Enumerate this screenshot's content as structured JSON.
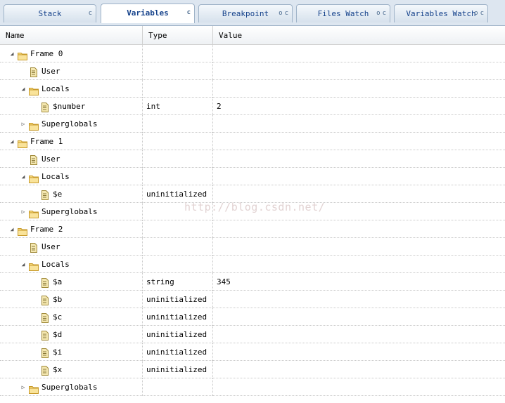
{
  "tabs": [
    {
      "label": "Stack",
      "active": false,
      "ctrls": [
        "c"
      ]
    },
    {
      "label": "Variables",
      "active": true,
      "ctrls": [
        "c"
      ]
    },
    {
      "label": "Breakpoint",
      "active": false,
      "ctrls": [
        "o",
        "c"
      ]
    },
    {
      "label": "Files Watch",
      "active": false,
      "ctrls": [
        "o",
        "c"
      ]
    },
    {
      "label": "Variables Watch",
      "active": false,
      "ctrls": [
        "o",
        "c"
      ]
    }
  ],
  "columns": {
    "name": "Name",
    "type": "Type",
    "value": "Value"
  },
  "rows": [
    {
      "level": 0,
      "kind": "folder",
      "twisty": "open",
      "name": "Frame 0",
      "type": "",
      "value": ""
    },
    {
      "level": 1,
      "kind": "file",
      "twisty": "none",
      "name": "User",
      "type": "",
      "value": ""
    },
    {
      "level": 1,
      "kind": "folder",
      "twisty": "open",
      "name": "Locals",
      "type": "",
      "value": ""
    },
    {
      "level": 2,
      "kind": "file",
      "twisty": "none",
      "name": "$number",
      "type": "int",
      "value": "2"
    },
    {
      "level": 1,
      "kind": "folder",
      "twisty": "closed",
      "name": "Superglobals",
      "type": "",
      "value": ""
    },
    {
      "level": 0,
      "kind": "folder",
      "twisty": "open",
      "name": "Frame 1",
      "type": "",
      "value": ""
    },
    {
      "level": 1,
      "kind": "file",
      "twisty": "none",
      "name": "User",
      "type": "",
      "value": ""
    },
    {
      "level": 1,
      "kind": "folder",
      "twisty": "open",
      "name": "Locals",
      "type": "",
      "value": ""
    },
    {
      "level": 2,
      "kind": "file",
      "twisty": "none",
      "name": "$e",
      "type": "uninitialized",
      "value": ""
    },
    {
      "level": 1,
      "kind": "folder",
      "twisty": "closed",
      "name": "Superglobals",
      "type": "",
      "value": ""
    },
    {
      "level": 0,
      "kind": "folder",
      "twisty": "open",
      "name": "Frame 2",
      "type": "",
      "value": ""
    },
    {
      "level": 1,
      "kind": "file",
      "twisty": "none",
      "name": "User",
      "type": "",
      "value": ""
    },
    {
      "level": 1,
      "kind": "folder",
      "twisty": "open",
      "name": "Locals",
      "type": "",
      "value": ""
    },
    {
      "level": 2,
      "kind": "file",
      "twisty": "none",
      "name": "$a",
      "type": "string",
      "value": "345"
    },
    {
      "level": 2,
      "kind": "file",
      "twisty": "none",
      "name": "$b",
      "type": "uninitialized",
      "value": ""
    },
    {
      "level": 2,
      "kind": "file",
      "twisty": "none",
      "name": "$c",
      "type": "uninitialized",
      "value": ""
    },
    {
      "level": 2,
      "kind": "file",
      "twisty": "none",
      "name": "$d",
      "type": "uninitialized",
      "value": ""
    },
    {
      "level": 2,
      "kind": "file",
      "twisty": "none",
      "name": "$i",
      "type": "uninitialized",
      "value": ""
    },
    {
      "level": 2,
      "kind": "file",
      "twisty": "none",
      "name": "$x",
      "type": "uninitialized",
      "value": ""
    },
    {
      "level": 1,
      "kind": "folder",
      "twisty": "closed",
      "name": "Superglobals",
      "type": "",
      "value": ""
    }
  ],
  "watermark": "http://blog.csdn.net/",
  "colors": {
    "tab_text": "#15428b",
    "tab_border": "#9fb3c8",
    "folder": "#f2c94c",
    "file": "#e8d48a"
  }
}
